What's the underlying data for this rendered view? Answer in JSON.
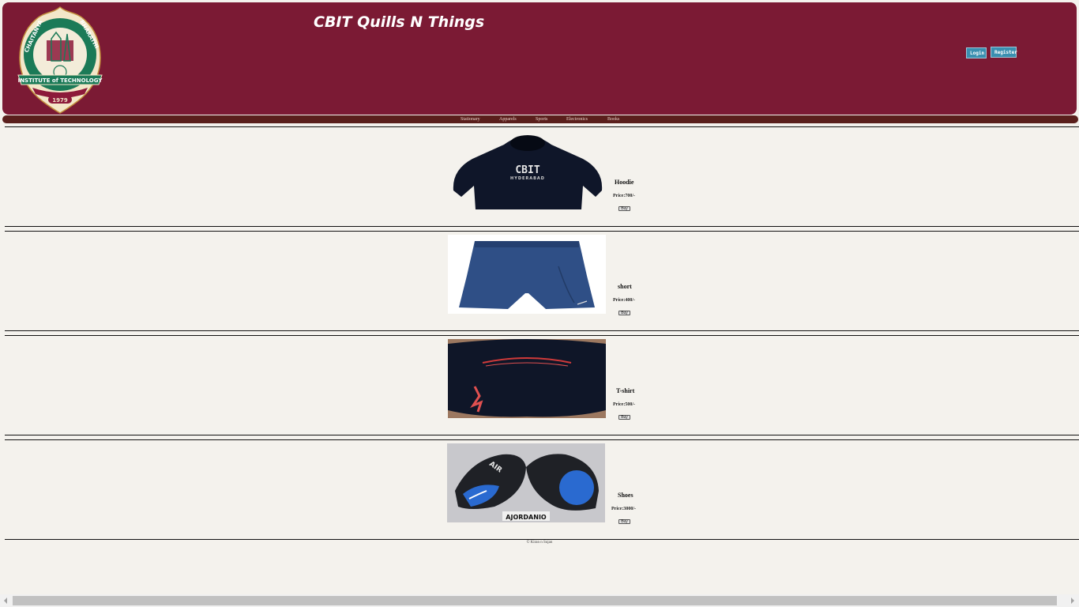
{
  "header": {
    "title": "CBIT Quills N Things",
    "login_label": "Login",
    "register_label": "Register",
    "logo_text": {
      "ring_left": "CHAITANYA",
      "ring_right": "BHARATHI",
      "banner": "INSTITUTE of TECHNOLOGY",
      "year": "1979"
    }
  },
  "nav": {
    "items": [
      "Stationary",
      "Apparels",
      "Sports",
      "Electronics",
      "Books"
    ]
  },
  "products": [
    {
      "name": "Hoodie",
      "price": "Price:700/-",
      "buy_label": "Buy",
      "image": "black-hoodie-image",
      "print": "CBIT",
      "print_sub": "HYDERABAD"
    },
    {
      "name": "short",
      "price": "Price:400/-",
      "buy_label": "Buy",
      "image": "blue-shorts-image"
    },
    {
      "name": "T-shirt",
      "price": "Price:500/-",
      "buy_label": "Buy",
      "image": "black-tshirt-image"
    },
    {
      "name": "Shoes",
      "price": "Price:3000/-",
      "buy_label": "Buy",
      "image": "blue-black-shoes-image",
      "shoe_text": "AIR",
      "brand_text": "AJORDANIO"
    }
  ],
  "footer": {
    "text": "© Kiran n Sujan"
  },
  "colors": {
    "header_bg": "#7b1a34",
    "nav_bg": "#5a1f1c",
    "button_bg": "#3a8fb0",
    "page_bg": "#f4f2ed"
  }
}
